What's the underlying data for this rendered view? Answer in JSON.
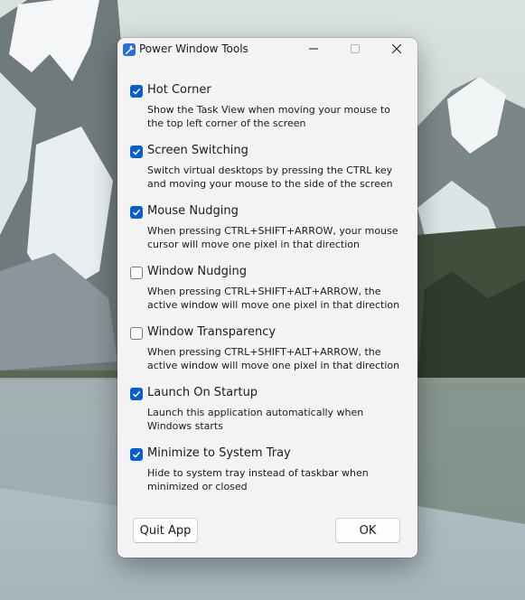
{
  "window": {
    "title": "Power Window Tools",
    "icon": "wrench-icon",
    "controls": {
      "minimize": "minimize-icon",
      "maximize": "maximize-icon",
      "close": "close-icon"
    }
  },
  "options": [
    {
      "label": "Hot Corner",
      "checked": true,
      "description": "Show the Task View when moving your mouse to the top left corner of the screen"
    },
    {
      "label": "Screen Switching",
      "checked": true,
      "description": "Switch virtual desktops by pressing the CTRL key and moving your mouse to the side of the screen"
    },
    {
      "label": "Mouse Nudging",
      "checked": true,
      "description": "When pressing CTRL+SHIFT+ARROW, your mouse cursor will move one pixel in that direction"
    },
    {
      "label": "Window Nudging",
      "checked": false,
      "description": "When pressing CTRL+SHIFT+ALT+ARROW, the active window will move one pixel in that direction"
    },
    {
      "label": "Window Transparency",
      "checked": false,
      "description": "When pressing CTRL+SHIFT+ALT+ARROW, the active window will move one pixel in that direction"
    },
    {
      "label": "Launch On Startup",
      "checked": true,
      "description": "Launch this application automatically when Windows starts"
    },
    {
      "label": "Minimize to System Tray",
      "checked": true,
      "description": "Hide to system tray instead of taskbar when minimized or closed"
    }
  ],
  "buttons": {
    "quit": "Quit App",
    "ok": "OK"
  },
  "colors": {
    "accent": "#0a5ecc",
    "window_bg": "#f3f3f3"
  }
}
